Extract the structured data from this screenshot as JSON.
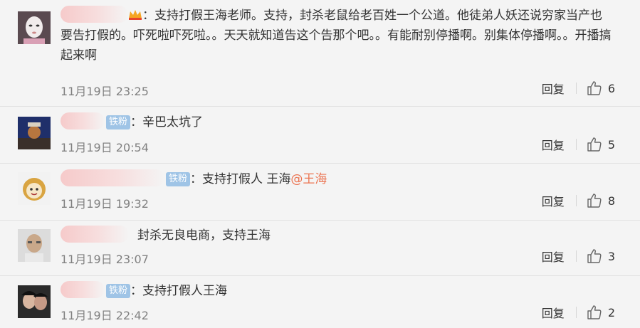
{
  "comments": [
    {
      "text": "：支持打假王海老师。支持，封杀老鼠给老百姓一个公道。他徒弟人妖还说穷家当产也要告打假的。吓死啦吓死啦。。天天就知道告这个告那个吧。。有能耐别停播啊。别集体停播啊。。开播搞起来啊",
      "time": "11月19日 23:25",
      "reply": "回复",
      "likes": "6"
    },
    {
      "badge": "铁粉",
      "text": "：辛巴太坑了",
      "time": "11月19日 20:54",
      "reply": "回复",
      "likes": "5"
    },
    {
      "badge": "铁粉",
      "text": "：支持打假人 王海",
      "mention": "@王海",
      "time": "11月19日 19:32",
      "reply": "回复",
      "likes": "8"
    },
    {
      "text": "封杀无良电商，支持王海",
      "time": "11月19日 23:07",
      "reply": "回复",
      "likes": "3"
    },
    {
      "badge": "铁粉",
      "text": "：支持打假人王海",
      "time": "11月19日 22:42",
      "reply": "回复",
      "likes": "2"
    }
  ],
  "colors": {
    "mention": "#eb7350",
    "badge": "#9fc4e6",
    "time": "#808080"
  },
  "icons": {
    "like": "thumbs-up-icon",
    "crown": "crown-icon"
  }
}
